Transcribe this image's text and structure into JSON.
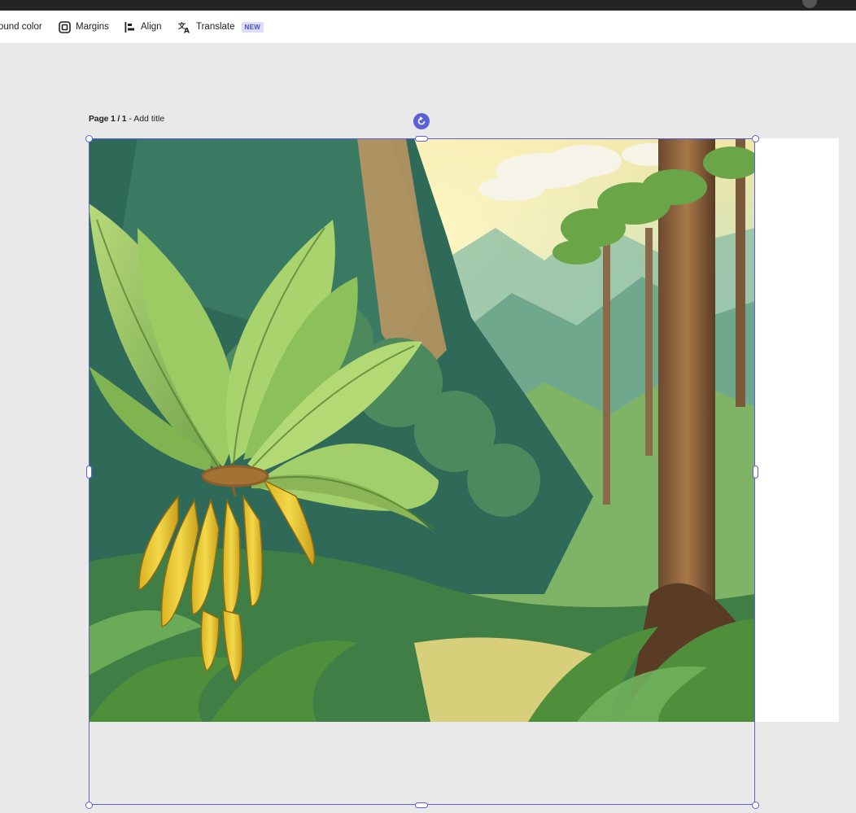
{
  "toolbar": {
    "background_color_label": "ound color",
    "margins_label": "Margins",
    "align_label": "Align",
    "translate_label": "Translate",
    "translate_badge": "NEW"
  },
  "page": {
    "page_number": "Page 1 / 1",
    "separator": " - ",
    "add_title": "Add title"
  },
  "canvas": {
    "image_subject": "banana-jungle-illustration",
    "selection_color": "#5c62d6",
    "background": "#e9e9e9"
  }
}
